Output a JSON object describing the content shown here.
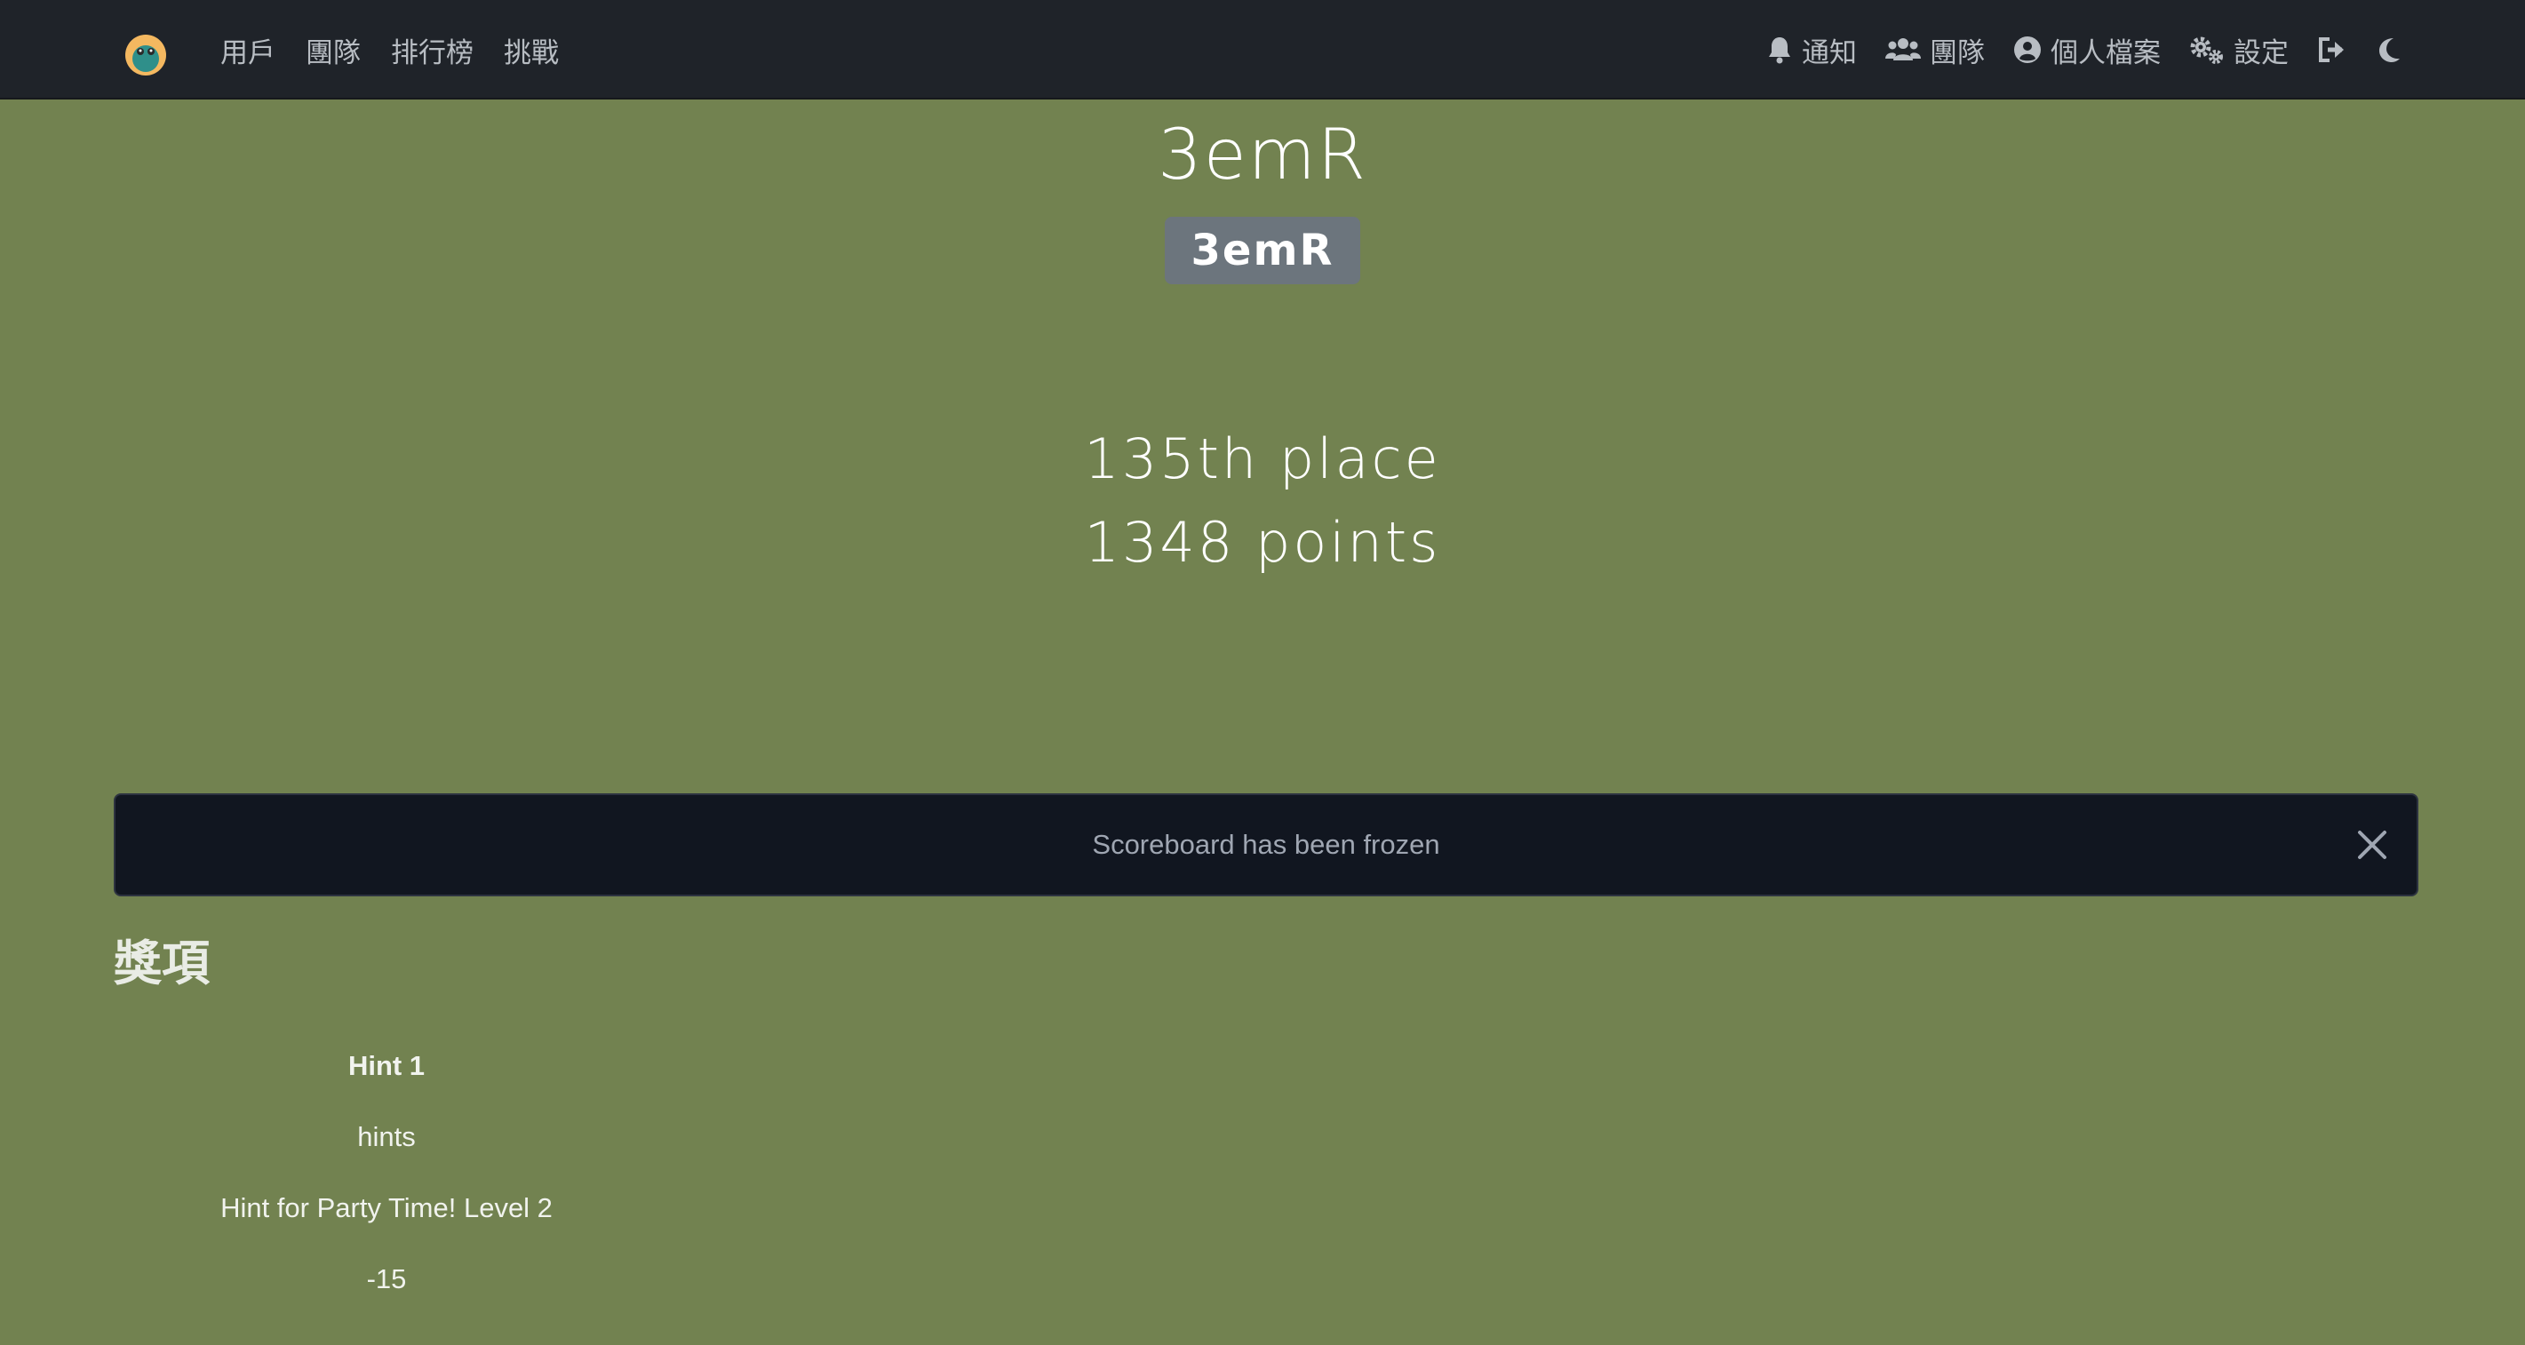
{
  "nav": {
    "left_links": [
      "用戶",
      "團隊",
      "排行榜",
      "挑戰"
    ],
    "right_items": {
      "notifications": "通知",
      "team": "團隊",
      "profile": "個人檔案",
      "settings": "設定"
    }
  },
  "team": {
    "name": "3emR",
    "badge": "3emR",
    "place": "135th place",
    "points": "1348 points"
  },
  "alert": {
    "message": "Scoreboard has been frozen"
  },
  "awards": {
    "heading": "獎項",
    "entries": [
      {
        "name": "Hint 1",
        "category": "hints",
        "description": "Hint for Party Time! Level 2",
        "value": "-15"
      }
    ]
  }
}
